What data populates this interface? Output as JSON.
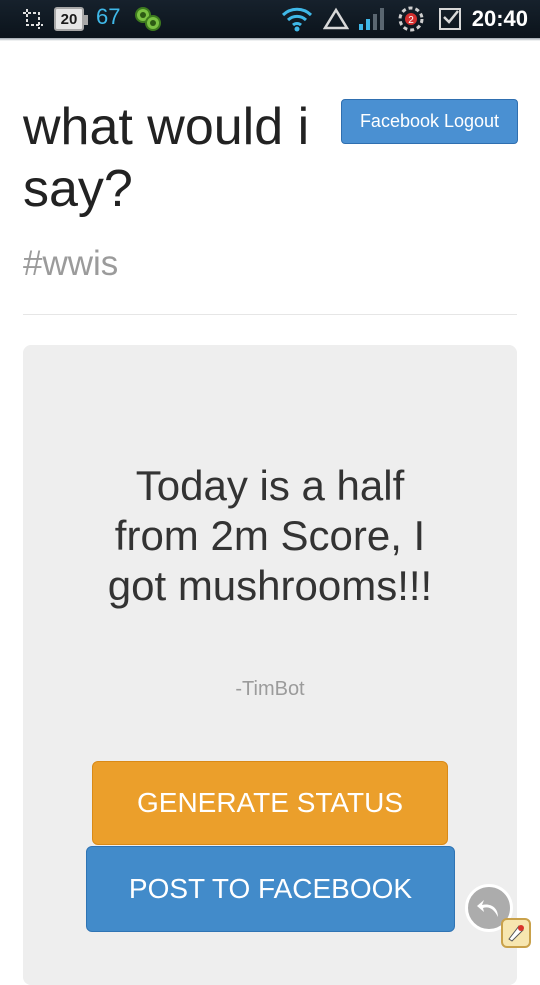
{
  "status_bar": {
    "calendar_date": "20",
    "notification_count": "67",
    "sync_badge": "2",
    "time": "20:40",
    "icons": [
      "crop-icon",
      "calendar-icon",
      "app-icon",
      "wifi-icon",
      "warning-triangle-icon",
      "signal-icon",
      "sync-icon",
      "checkbox-icon"
    ]
  },
  "header": {
    "title": "what would i say?",
    "logout_label": "Facebook Logout",
    "hashtag": "#wwis"
  },
  "card": {
    "quote": "Today is a half from 2m Score, I got mushrooms!!!",
    "attribution": "-TimBot",
    "generate_label": "GENERATE STATUS",
    "post_label": "POST TO FACEBOOK"
  },
  "colors": {
    "logout_blue": "#4a90d2",
    "generate_orange": "#eb9f2b",
    "post_blue": "#428bca",
    "card_bg": "#eeeeee"
  }
}
